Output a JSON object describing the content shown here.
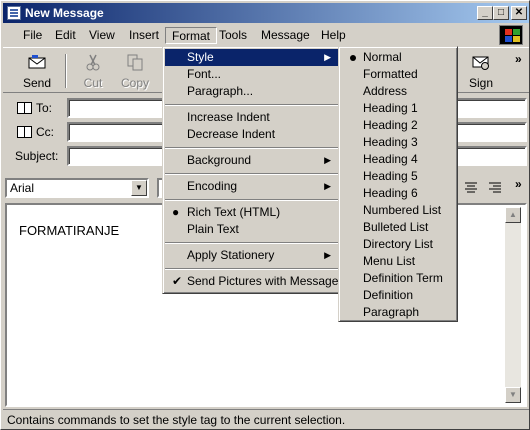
{
  "window": {
    "title": "New Message"
  },
  "menubar": {
    "items": [
      {
        "label": "File",
        "accel": "F"
      },
      {
        "label": "Edit",
        "accel": "E"
      },
      {
        "label": "View",
        "accel": "V"
      },
      {
        "label": "Insert",
        "accel": "I"
      },
      {
        "label": "Format",
        "accel": "o"
      },
      {
        "label": "Tools",
        "accel": "T"
      },
      {
        "label": "Message",
        "accel": "M"
      },
      {
        "label": "Help",
        "accel": "H"
      }
    ]
  },
  "toolbar": {
    "send": {
      "label": "Send",
      "icon": "send-icon"
    },
    "cut": {
      "label": "Cut",
      "icon": "scissors-icon",
      "disabled": true
    },
    "copy": {
      "label": "Copy",
      "icon": "copy-icon",
      "disabled": true
    },
    "sign": {
      "label": "Sign",
      "icon": "sign-icon"
    },
    "more": "»"
  },
  "fields": {
    "to_label": "To:",
    "cc_label": "Cc:",
    "subject_label": "Subject:",
    "to_value": "",
    "cc_value": "",
    "subject_value": ""
  },
  "formatbar": {
    "font": "Arial",
    "more": "»"
  },
  "editor": {
    "text": "FORMATIRANJE"
  },
  "status": {
    "text": "Contains commands to set the style tag to the current selection."
  },
  "format_menu": {
    "items": [
      {
        "label": "Style",
        "accel": "S",
        "submenu": true,
        "selected": true
      },
      {
        "label": "Font...",
        "accel": "F"
      },
      {
        "label": "Paragraph...",
        "accel": "P"
      },
      {
        "label": "Increase Indent",
        "accel": "I"
      },
      {
        "label": "Decrease Indent",
        "accel": "D"
      },
      {
        "label": "Background",
        "accel": "B",
        "submenu": true
      },
      {
        "label": "Encoding",
        "accel": "E",
        "submenu": true
      },
      {
        "label": "Rich Text (HTML)",
        "accel": "R",
        "radio": true
      },
      {
        "label": "Plain Text",
        "accel": "x"
      },
      {
        "label": "Apply Stationery",
        "accel": "S",
        "submenu": true
      },
      {
        "label": "Send Pictures with Message",
        "accel": "P",
        "checked": true
      }
    ]
  },
  "style_submenu": {
    "items": [
      "Normal",
      "Formatted",
      "Address",
      "Heading 1",
      "Heading 2",
      "Heading 3",
      "Heading 4",
      "Heading 5",
      "Heading 6",
      "Numbered List",
      "Bulleted List",
      "Directory List",
      "Menu List",
      "Definition Term",
      "Definition",
      "Paragraph"
    ],
    "selected": "Normal"
  },
  "colors": {
    "titlebar_start": "#0a246a",
    "titlebar_end": "#a6caf0",
    "selection": "#0a246a"
  }
}
